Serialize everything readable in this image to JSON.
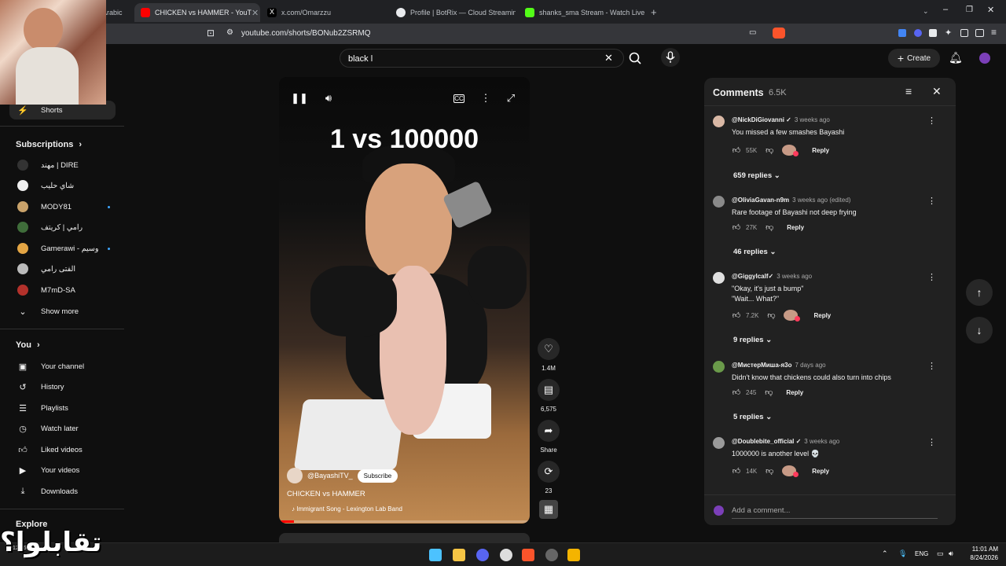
{
  "browser": {
    "tabs": [
      {
        "label": "Arabic",
        "active": false
      },
      {
        "label": "CHICKEN vs HAMMER - YouT",
        "active": true
      },
      {
        "label": "x.com/Omarzzu",
        "active": false
      },
      {
        "label": "Profile | BotRix — Cloud Streaming B",
        "active": false
      },
      {
        "label": "shanks_sma Stream - Watch Live on K",
        "active": false
      }
    ],
    "url": "youtube.com/shorts/BONub2ZSRMQ"
  },
  "header": {
    "search_value": "black l",
    "create_label": "Create"
  },
  "sidebar": {
    "shorts_label": "Shorts",
    "subscriptions_label": "Subscriptions",
    "subscriptions": [
      {
        "name": "مهند | DIRE",
        "dot": false
      },
      {
        "name": "شاي حليب",
        "dot": false
      },
      {
        "name": "MODY81",
        "dot": true
      },
      {
        "name": "رامي | كريتف",
        "dot": false
      },
      {
        "name": "Gamerawi - وسيم",
        "dot": true
      },
      {
        "name": "الفتى رامي",
        "dot": false
      },
      {
        "name": "M7mD-SA",
        "dot": false
      }
    ],
    "show_more": "Show more",
    "you_label": "You",
    "you_items": [
      {
        "label": "Your channel",
        "icon": "person-icon"
      },
      {
        "label": "History",
        "icon": "history-icon"
      },
      {
        "label": "Playlists",
        "icon": "playlist-icon"
      },
      {
        "label": "Watch later",
        "icon": "clock-icon"
      },
      {
        "label": "Liked videos",
        "icon": "thumbs-up-icon"
      },
      {
        "label": "Your videos",
        "icon": "video-icon"
      },
      {
        "label": "Downloads",
        "icon": "download-icon"
      }
    ],
    "explore_label": "Explore"
  },
  "short": {
    "overlay_title": "1 vs 100000",
    "channel": "@BayashiTV_",
    "subscribe_label": "Subscribe",
    "title": "CHICKEN vs HAMMER",
    "song": "Immigrant Song - Lexington Lab Band",
    "progress": 0.06,
    "actions": {
      "likes": "1.4M",
      "comments": "6,575",
      "share": "Share",
      "remix": "23"
    }
  },
  "comments_panel": {
    "title": "Comments",
    "count": "6.5K",
    "items": [
      {
        "author": "@NickDiGiovanni ✓",
        "time": "3 weeks ago",
        "text": [
          "You missed a few smashes Bayashi"
        ],
        "likes": "55K",
        "creator_heart": true,
        "replies": "659 replies",
        "avatar": "#d9b8a5"
      },
      {
        "author": "@OliviaGavan-n9m",
        "time": "3 weeks ago (edited)",
        "text": [
          "Rare footage of Bayashi not deep frying"
        ],
        "likes": "27K",
        "creator_heart": false,
        "replies": "46 replies",
        "avatar": "#8a8a8a"
      },
      {
        "author": "@Giggylcalf✓",
        "time": "3 weeks ago",
        "text": [
          "\"Okay, it's just a bump\"",
          "\"Wait... What?\""
        ],
        "likes": "7.2K",
        "creator_heart": true,
        "replies": "9 replies",
        "avatar": "#e0e0e0"
      },
      {
        "author": "@МистерМиша-я3о",
        "time": "7 days ago",
        "text": [
          "Didn't know that chickens could also turn into chips"
        ],
        "likes": "245",
        "creator_heart": false,
        "replies": "5 replies",
        "avatar": "#6a9a4a"
      },
      {
        "author": "@Doublebite_official ✓",
        "time": "3 weeks ago",
        "text": [
          "1000000 is another level 💀"
        ],
        "likes": "14K",
        "creator_heart": true,
        "replies": "",
        "avatar": "#9a9a9a"
      }
    ],
    "reply_label": "Reply",
    "add_placeholder": "Add a comment..."
  },
  "overlay_text": "تقابلوا؟",
  "taskbar": {
    "lang": "ENG",
    "time": "11:01 AM",
    "date": "8/24/2026",
    "left_time": "12:16 PM"
  },
  "colors": {
    "bg": "#0f0f0f",
    "panel": "#212121",
    "accent_red": "#ff0000",
    "link_blue": "#3ea6ff"
  }
}
